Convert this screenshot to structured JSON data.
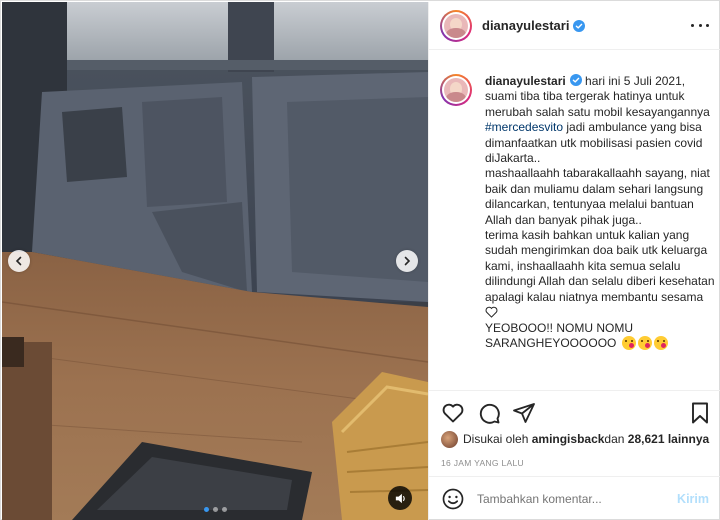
{
  "post": {
    "username": "dianayulestari",
    "verified": true
  },
  "media": {
    "description_icons": [
      "chevron-left-icon",
      "chevron-right-icon",
      "audio-icon"
    ],
    "slide_count": 3,
    "active_slide": 1
  },
  "caption": {
    "username": "dianayulestari",
    "text_before_hashtag": "hari ini 5 Juli 2021, suami tiba tiba tergerak hatinya untuk merubah salah satu mobil kesayangannya ",
    "hashtag": "#mercedesvito",
    "text_after_hashtag": " jadi ambulance yang bisa dimanfaatkan utk mobilisasi pasien covid diJakarta..\nmashaallaahh tabarakallaahh sayang, niat baik dan muliamu dalam sehari langsung dilancarkan, tentunyaa melalui bantuan Allah dan banyak pihak juga..\nterima kasih bahkan untuk kalian yang sudah mengirimkan doa baik utk keluarga kami, inshaallaahh kita semua selalu dilindungi Allah dan selalu diberi kesehatan apalagi kalau niatnya membantu sesama ",
    "line_last": "\nYEOBOOO!! NOMU NOMU\nSARANGHEYOOOOOO "
  },
  "likes": {
    "prefix": "Disukai oleh ",
    "user": "amingisback",
    "middle": " dan ",
    "count": "28,621 lainnya"
  },
  "timestamp": "16 JAM YANG LALU",
  "comment": {
    "placeholder": "Tambahkan komentar...",
    "post_label": "Kirim"
  },
  "colors": {
    "verified": "#3897f0",
    "link": "#00376b",
    "post_disabled": "#b2dffc"
  }
}
